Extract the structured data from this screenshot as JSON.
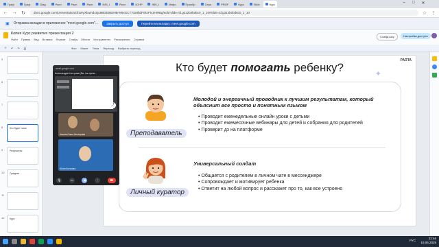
{
  "tabs": [
    {
      "label": "Граф"
    },
    {
      "label": "Граф"
    },
    {
      "label": "Diag"
    },
    {
      "label": "Расп"
    },
    {
      "label": "Расп"
    },
    {
      "label": "Расп"
    },
    {
      "label": "IMS_I"
    },
    {
      "label": "Расп"
    },
    {
      "label": "1CHP"
    },
    {
      "label": "IMS_I"
    },
    {
      "label": "Инфо"
    },
    {
      "label": "Приобр"
    },
    {
      "label": "Сери"
    },
    {
      "label": "PROF"
    },
    {
      "label": "Курс"
    },
    {
      "label": "Slide"
    },
    {
      "label": "Курс"
    }
  ],
  "address": {
    "url": "docs.google.com/presentation/d/1WyXbumd4Qu8BDE8B0HB-M9xGC77t1MbdP0kzFN1HWBg/edit?slide=id.g312b0bd6c0_1_10#slide=id.g312b0bd6c0_1_10"
  },
  "banner": {
    "text": "Отправка вкладки в приложение \"meet.google.com\"...",
    "share_button": "Закрыть доступ",
    "switch_button": "Перейти на вкладку: meet.google.com"
  },
  "doc": {
    "title": "Копия Курс развития презентация 2",
    "menu": [
      "Файл",
      "Правка",
      "Вид",
      "Вставка",
      "Формат",
      "Слайд",
      "Объект",
      "Инструменты",
      "Расширения",
      "Справка"
    ],
    "toolbar_items": [
      "Фон",
      "Макет",
      "Тема",
      "Переход",
      "Выбрать переход"
    ],
    "slideshow_button": "Слайд-шоу",
    "access_button": "Настройки доступа"
  },
  "filmstrip": {
    "numbers": [
      "5",
      "6",
      "7",
      "8",
      "9",
      "10",
      "11",
      "12"
    ],
    "labels": [
      "",
      "",
      "",
      "Кто будет помо",
      "Результаты",
      "Среднее",
      "",
      "Курс"
    ]
  },
  "meet": {
    "header": "meet.google.com",
    "title": "Александра Кострова (Вы, на презе...",
    "participant1": "Ксения Ольга Нестерова",
    "participant2": "Юлия Кострова"
  },
  "slide": {
    "title_before": "Кто будет ",
    "title_bold": "помогать",
    "title_after": " ребенку?",
    "brand": "PARTA",
    "teacher": {
      "role": "Преподаватель",
      "heading": "Молодой и энергичный проводник к лучшим результатам, который объяснит все просто и понятным языком",
      "bullets": [
        "Проводит еженедельные онлайн уроки с детьми",
        "Проводит ежемесячные вебинары для детей и собрания для родителей",
        "Проверит дз на платформе"
      ]
    },
    "curator": {
      "role": "Личный куратор",
      "heading": "Универсальный солдат",
      "bullets": [
        "Общается с родителем в личном чате в мессенджере",
        "Сопровождает и мотивирует ребенка",
        "Ответит на любой вопрос и расскажет про то, как все устроено"
      ]
    }
  },
  "taskbar": {
    "tray_lang": "РУС",
    "time": "22:46",
    "date": "19.06.2025"
  },
  "colors": {
    "accent": "#1a73e8",
    "pill": "#dfe3f5"
  }
}
